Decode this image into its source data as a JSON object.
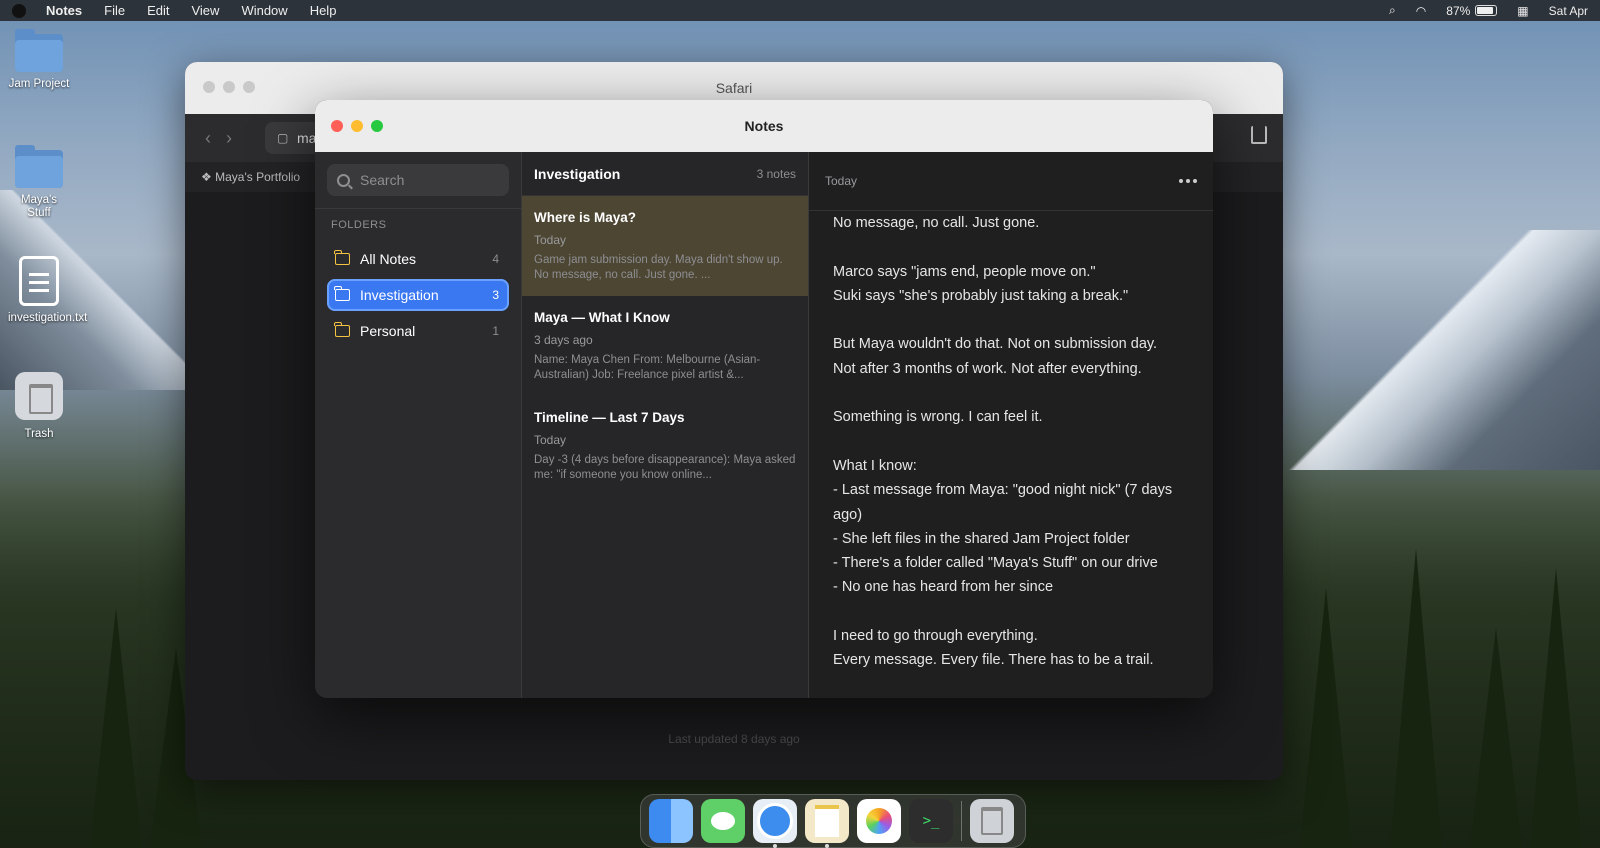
{
  "menubar": {
    "app": "Notes",
    "items": [
      "File",
      "Edit",
      "View",
      "Window",
      "Help"
    ],
    "battery": "87%",
    "clock": "Sat Apr"
  },
  "desktop": {
    "icons": [
      {
        "label": "Jam Project",
        "kind": "folder"
      },
      {
        "label": "Maya's Stuff",
        "kind": "folder"
      },
      {
        "label": "investigation.txt",
        "kind": "document"
      },
      {
        "label": "Trash",
        "kind": "trash"
      }
    ]
  },
  "safari": {
    "title": "Safari",
    "url_partial": "ma",
    "bookmark": "Maya's Portfolio",
    "footer": "Last updated 8 days ago"
  },
  "notes": {
    "title": "Notes",
    "search_placeholder": "Search",
    "folders_heading": "FOLDERS",
    "folders": [
      {
        "name": "All Notes",
        "count": "4"
      },
      {
        "name": "Investigation",
        "count": "3",
        "active": true
      },
      {
        "name": "Personal",
        "count": "1"
      }
    ],
    "list": {
      "folder": "Investigation",
      "count": "3 notes",
      "notes": [
        {
          "title": "Where is Maya?",
          "date": "Today",
          "preview": "Game jam submission day. Maya didn't show up. No message, no call. Just gone. ...",
          "active": true
        },
        {
          "title": "Maya — What I Know",
          "date": "3 days ago",
          "preview": "Name: Maya Chen From: Melbourne (Asian-Australian) Job: Freelance pixel artist &..."
        },
        {
          "title": "Timeline — Last 7 Days",
          "date": "Today",
          "preview": "Day -3 (4 days before disappearance): Maya asked me: \"if someone you know online..."
        }
      ]
    },
    "editor": {
      "date": "Today",
      "lines": [
        "No message, no call. Just gone.",
        "",
        "Marco says \"jams end, people move on.\"",
        "Suki says \"she's probably just taking a break.\"",
        "",
        "But Maya wouldn't do that. Not on submission day.",
        "Not after 3 months of work. Not after everything.",
        "",
        "Something is wrong. I can feel it.",
        "",
        "What I know:",
        "- Last message from Maya: \"good night nick\" (7 days",
        "ago)",
        "- She left files in the shared Jam Project folder",
        "- There's a folder called \"Maya's Stuff\" on our drive",
        "- No one has heard from her since",
        "",
        "I need to go through everything.",
        "Every message. Every file. There has to be a trail."
      ]
    }
  },
  "dock": {
    "apps": [
      "finder-icon",
      "messages-icon",
      "safari-icon",
      "notes-icon",
      "photos-icon",
      "terminal-icon",
      "trash-icon"
    ],
    "terminal_glyph": ">_"
  },
  "colors": {
    "accent": "#3a78f2",
    "selected_note": "#4c4632",
    "folder_icon": "#f5c242"
  }
}
